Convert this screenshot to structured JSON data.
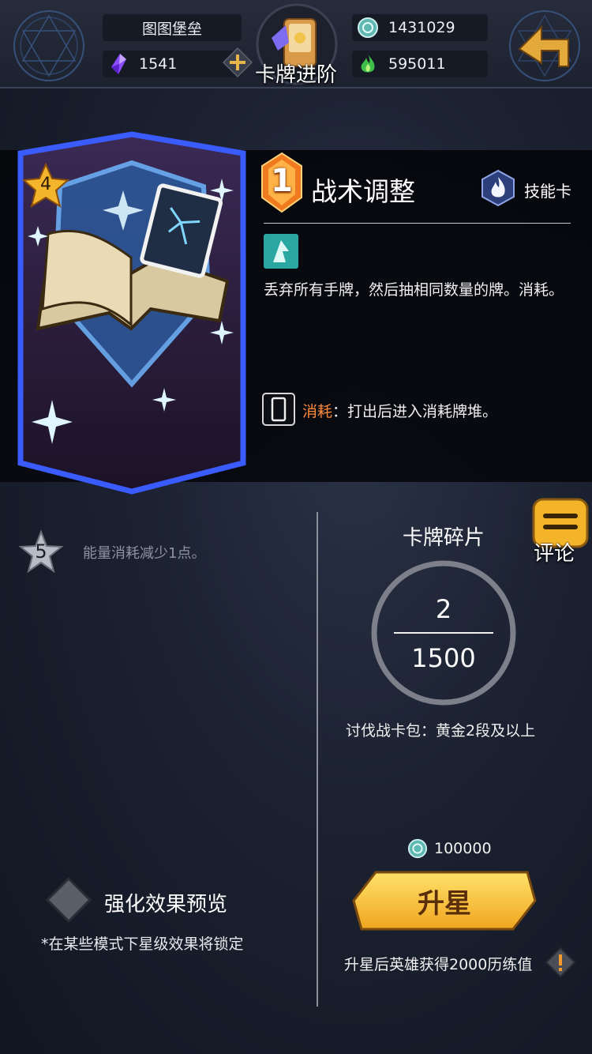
{
  "header": {
    "title": "卡牌进阶",
    "player_name": "图图堡垒",
    "gems": "1541",
    "coins": "1431029",
    "wood": "595011"
  },
  "card": {
    "cost": "1",
    "star_level": "4",
    "name": "战术调整",
    "type_label": "技能卡",
    "description": "丢弃所有手牌，然后抽相同数量的牌。消耗。",
    "keyword": "消耗",
    "keyword_desc": "：打出后进入消耗牌堆。"
  },
  "next_star": {
    "level": "5",
    "effect": "能量消耗减少1点。"
  },
  "preview": {
    "label": "强化效果预览",
    "note": "*在某些模式下星级效果将锁定"
  },
  "comment_button": {
    "label": "评论"
  },
  "fragments": {
    "title": "卡牌碎片",
    "have": "2",
    "need": "1500",
    "source": "讨伐战卡包：黄金2段及以上"
  },
  "upgrade": {
    "cost": "100000",
    "button_label": "升星",
    "reward_note": "升星后英雄获得2000历练值"
  },
  "colors": {
    "accent_gold": "#f3c53a",
    "keyword_orange": "#ff8a3a",
    "card_frame_blue": "#3a5cff"
  },
  "icons": {
    "gem": "purple-crystal-icon",
    "coin": "teal-coin-icon",
    "wood": "green-flame-icon",
    "back": "gold-return-arrow-icon",
    "type": "skill-card-flame-icon"
  }
}
